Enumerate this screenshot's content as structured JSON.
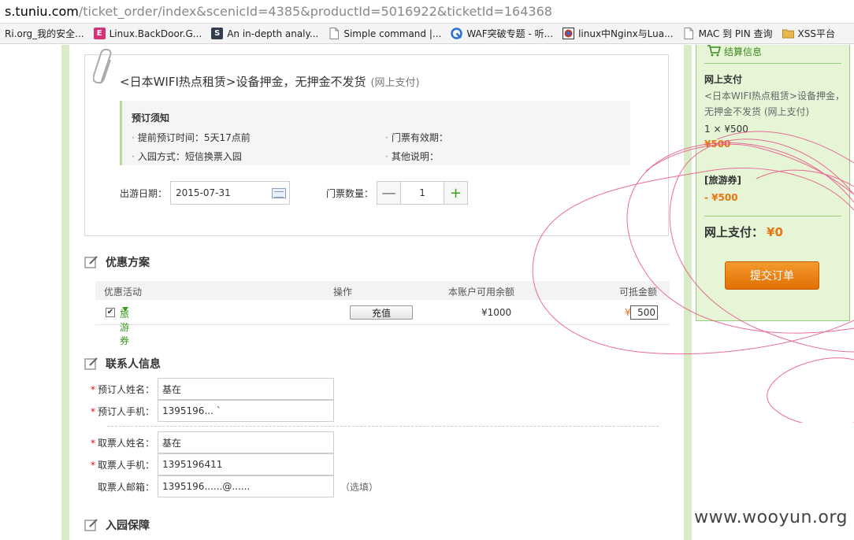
{
  "browser": {
    "url_host": "s.tuniu.com",
    "url_path": "/ticket_order/index&scenicId=4385&productId=5016922&ticketId=164368",
    "bookmarks": [
      {
        "label": "Ri.org_我的安全...",
        "icon": "none",
        "color": ""
      },
      {
        "label": "Linux.BackDoor.G...",
        "icon": "pink-square-icon",
        "color": "#d6337a"
      },
      {
        "label": "An in-depth analy...",
        "icon": "s-logo-icon",
        "color": "#333d4d"
      },
      {
        "label": "Simple command |...",
        "icon": "page-icon",
        "color": "#888888"
      },
      {
        "label": "WAF突破专题 - 听...",
        "icon": "swirl-icon",
        "color": "#2a6fd6"
      },
      {
        "label": "linux中Nginx与Lua...",
        "icon": "circle-logo-icon",
        "color": "#c0392b"
      },
      {
        "label": "MAC 到 PIN 查询",
        "icon": "page-icon",
        "color": "#888888"
      },
      {
        "label": "XSS平台",
        "icon": "folder-icon",
        "color": "#e8b64a"
      }
    ]
  },
  "product": {
    "title": "<日本WIFI热点租赁>设备押金，无押金不发货",
    "pay_type": "(网上支付)",
    "notice_heading": "预订须知",
    "notice_items": [
      "提前预订时间：5天17点前",
      "门票有效期：",
      "入园方式：短信换票入园",
      "其他说明："
    ],
    "date_label": "出游日期：",
    "date_value": "2015-07-31",
    "qty_label": "门票数量：",
    "qty_minus": "—",
    "qty_value": "1",
    "qty_plus": "+"
  },
  "promo": {
    "section_title": "优惠方案",
    "headers": [
      "优惠活动",
      "操作",
      "本账户可用余额",
      "可抵金额"
    ],
    "row": {
      "checked": true,
      "check_mark": "✔",
      "name": "旅游券",
      "recharge_label": "充值",
      "balance": "¥1000",
      "currency": "¥",
      "amount": "500"
    }
  },
  "contact": {
    "section_title": "联系人信息",
    "required_mark": "*",
    "fields": [
      {
        "label": "预订人姓名：",
        "value": "基在",
        "required": true
      },
      {
        "label": "预订人手机：",
        "value": "1395196... `",
        "required": true
      },
      {
        "label": "取票人姓名：",
        "value": "基在",
        "required": true
      },
      {
        "label": "取票人手机：",
        "value": "1395196411",
        "required": true
      },
      {
        "label": "取票人邮箱：",
        "value": "1395196......@......",
        "required": false,
        "optional": "（选填）"
      }
    ]
  },
  "guarantee": {
    "section_title": "入园保障"
  },
  "summary": {
    "title": "结算信息",
    "pay_heading": "网上支付",
    "item_desc": "<日本WIFI热点租赁>设备押金，无押金不发货 (网上支付)",
    "qty_price": "1 × ¥500",
    "subtotal": "¥500",
    "voucher_heading": "[旅游券]",
    "voucher_amount": "- ¥500",
    "total_label": "网上支付：",
    "total_value": "¥0",
    "submit_label": "提交订单"
  },
  "watermark": "www.wooyun.org",
  "colors": {
    "accent_green": "#3b9b1f",
    "summary_bg": "#e5f5d6",
    "price_orange": "#e87511",
    "submit_orange": "#e16f05",
    "scribble_pink": "#e8528a"
  }
}
